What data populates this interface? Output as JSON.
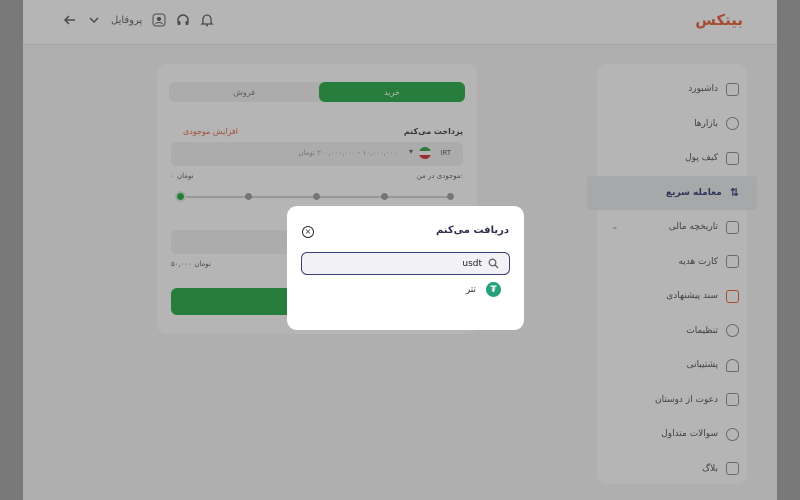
{
  "app": {
    "logo": "بیتکس",
    "accent": "#1aa53a",
    "brand": "#e4572e"
  },
  "topbar": {
    "user_label": "پروفایل",
    "icons": [
      "arrow-left-icon",
      "chevron-down-icon",
      "user-icon",
      "headset-icon",
      "bell-icon"
    ]
  },
  "sidebar": {
    "items": [
      {
        "label": "داشبورد",
        "icon": "dashboard-icon"
      },
      {
        "label": "بازارها",
        "icon": "markets-icon"
      },
      {
        "label": "کیف پول",
        "icon": "wallet-icon"
      },
      {
        "label": "معامله سریع",
        "icon": "swap-icon",
        "active": true
      },
      {
        "label": "تاریخچه مالی",
        "icon": "history-icon"
      },
      {
        "label": "کارت هدیه",
        "icon": "gift-icon"
      },
      {
        "label": "سند پیشنهادی",
        "icon": "document-icon"
      },
      {
        "label": "تنظیمات",
        "icon": "gear-icon"
      },
      {
        "label": "پشتیبانی",
        "icon": "headset-icon"
      },
      {
        "label": "دعوت از دوستان",
        "icon": "invite-icon"
      },
      {
        "label": "سوالات متداول",
        "icon": "question-icon"
      },
      {
        "label": "بلاگ",
        "icon": "blog-icon"
      }
    ]
  },
  "trade": {
    "tab_buy": "خرید",
    "tab_sell": "فروش",
    "pay_label": "پرداخت می‌کنم",
    "balance_link": "افزایش موجودی",
    "currency": "IRT",
    "amount_placeholder": "۱۰,۰۰۰,۰۰۰ - ۲۰۰,۰۰۰,۰۰۰ تومان",
    "balance_label": "موجودی در من:",
    "balance_value": "۰ تومان",
    "bottom_value": "۵۰,۰۰۰ تومان"
  },
  "modal": {
    "title": "دریافت می‌کنم",
    "search": {
      "value": "usdt",
      "placeholder": ""
    },
    "results": [
      {
        "label": "تتر",
        "icon": "tether-icon",
        "color": "#26a17b"
      }
    ]
  }
}
